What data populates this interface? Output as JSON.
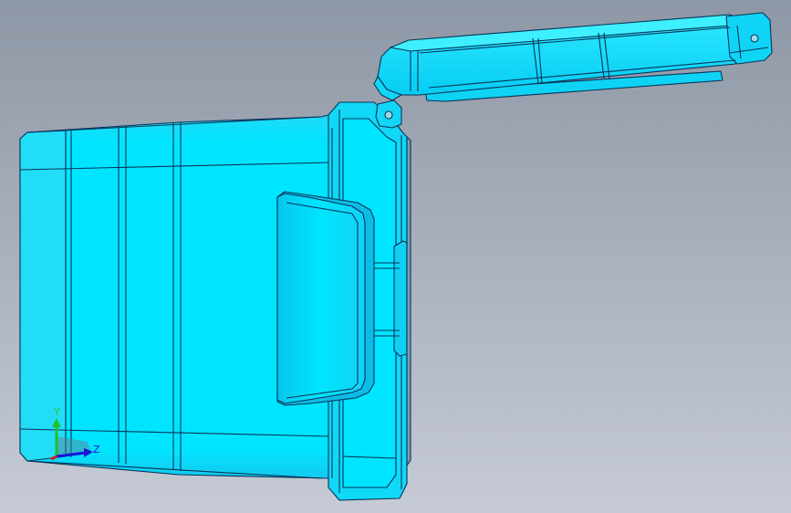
{
  "viewport": {
    "background_top": "#8e97a5",
    "background_bottom": "#c6cbd5"
  },
  "model": {
    "fill": "#00e5ff",
    "fill_light": "#4ff3ff",
    "fill_mid": "#15d8f5",
    "fill_dark": "#0a9fcf",
    "edge_color": "#08345a"
  },
  "triad": {
    "y_label": "Y",
    "z_label": "Z",
    "y_color": "#22c02a",
    "z_color": "#1616d8",
    "x_color": "#e01818"
  }
}
